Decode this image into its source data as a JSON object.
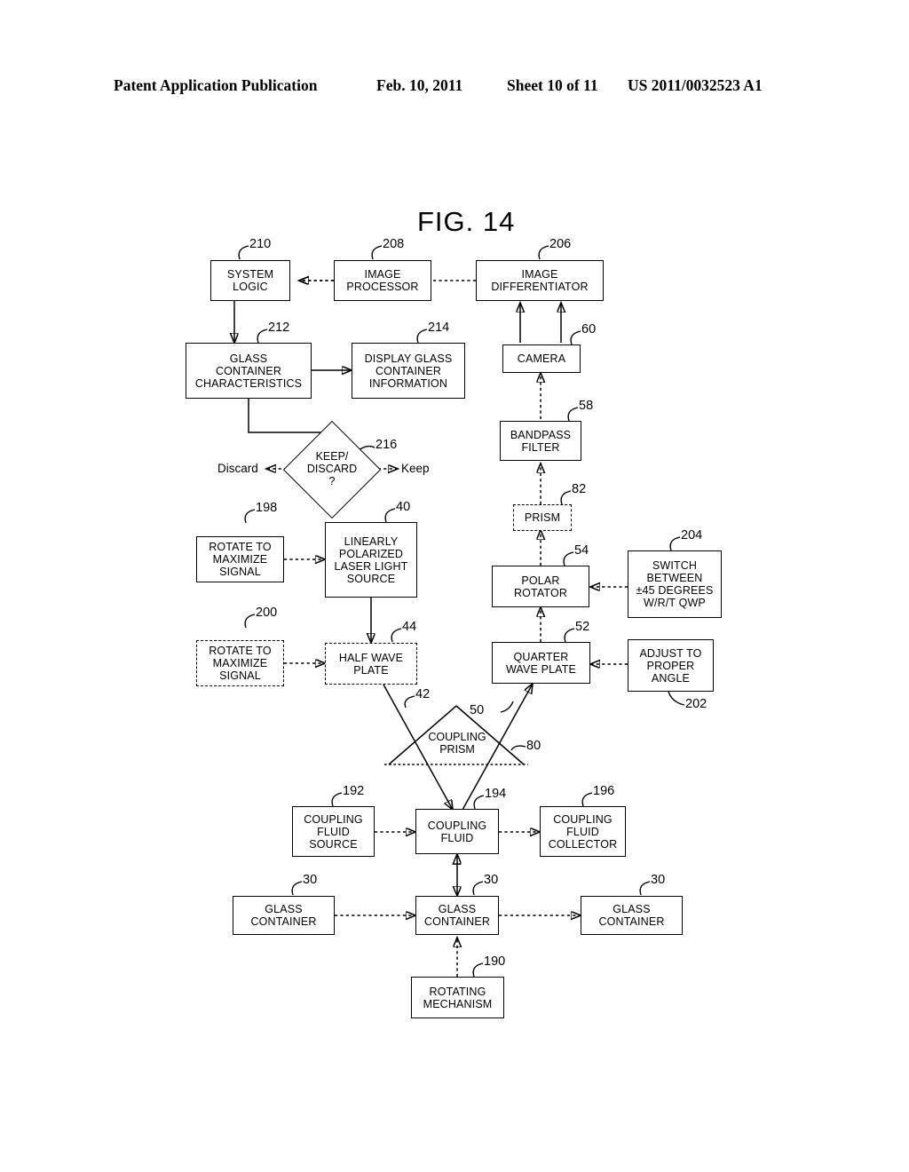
{
  "header": {
    "publication": "Patent Application Publication",
    "date": "Feb. 10, 2011",
    "sheet": "Sheet 10 of 11",
    "number": "US 2011/0032523 A1"
  },
  "figure": {
    "title": "FIG. 14"
  },
  "nodes": [
    {
      "id": "system-logic",
      "label": "SYSTEM\nLOGIC",
      "ref": "210",
      "style": "solid"
    },
    {
      "id": "image-processor",
      "label": "IMAGE\nPROCESSOR",
      "ref": "208",
      "style": "solid"
    },
    {
      "id": "image-differentiator",
      "label": "IMAGE\nDIFFERENTIATOR",
      "ref": "206",
      "style": "solid"
    },
    {
      "id": "glass-container-characteristics",
      "label": "GLASS\nCONTAINER\nCHARACTERISTICS",
      "ref": "212",
      "style": "solid"
    },
    {
      "id": "display-glass-container-information",
      "label": "DISPLAY GLASS\nCONTAINER\nINFORMATION",
      "ref": "214",
      "style": "solid"
    },
    {
      "id": "camera",
      "label": "CAMERA",
      "ref": "60",
      "style": "solid"
    },
    {
      "id": "bandpass-filter",
      "label": "BANDPASS\nFILTER",
      "ref": "58",
      "style": "solid"
    },
    {
      "id": "prism",
      "label": "PRISM",
      "ref": "82",
      "style": "dash"
    },
    {
      "id": "rotate-to-maximize-signal-198",
      "label": "ROTATE TO\nMAXIMIZE\nSIGNAL",
      "ref": "198",
      "style": "solid"
    },
    {
      "id": "linearly-polarized-laser-light-source",
      "label": "LINEARLY\nPOLARIZED\nLASER LIGHT\nSOURCE",
      "ref": "40",
      "style": "solid"
    },
    {
      "id": "polar-rotator",
      "label": "POLAR\nROTATOR",
      "ref": "54",
      "style": "solid"
    },
    {
      "id": "switch-between-degrees",
      "label": "SWITCH\nBETWEEN\n±45 DEGREES\nW/R/T QWP",
      "ref": "204",
      "style": "solid"
    },
    {
      "id": "rotate-to-maximize-signal-200",
      "label": "ROTATE TO\nMAXIMIZE\nSIGNAL",
      "ref": "200",
      "style": "dash"
    },
    {
      "id": "half-wave-plate",
      "label": "HALF WAVE\nPLATE",
      "ref": "44",
      "style": "dash"
    },
    {
      "id": "quarter-wave-plate",
      "label": "QUARTER\nWAVE PLATE",
      "ref": "52",
      "style": "solid"
    },
    {
      "id": "adjust-to-proper-angle",
      "label": "ADJUST TO\nPROPER\nANGLE",
      "ref": "202",
      "style": "solid"
    },
    {
      "id": "coupling-fluid-source",
      "label": "COUPLING\nFLUID\nSOURCE",
      "ref": "192",
      "style": "solid"
    },
    {
      "id": "coupling-fluid",
      "label": "COUPLING\nFLUID",
      "ref": "194",
      "style": "solid"
    },
    {
      "id": "coupling-fluid-collector",
      "label": "COUPLING\nFLUID\nCOLLECTOR",
      "ref": "196",
      "style": "solid"
    },
    {
      "id": "glass-container-left",
      "label": "GLASS\nCONTAINER",
      "ref": "30",
      "style": "solid"
    },
    {
      "id": "glass-container-center",
      "label": "GLASS\nCONTAINER",
      "ref": "30",
      "style": "solid"
    },
    {
      "id": "glass-container-right",
      "label": "GLASS\nCONTAINER",
      "ref": "30",
      "style": "solid"
    },
    {
      "id": "rotating-mechanism",
      "label": "ROTATING\nMECHANISM",
      "ref": "190",
      "style": "solid"
    }
  ],
  "decision": {
    "id": "keep-discard",
    "label": "KEEP/\nDISCARD\n?",
    "ref": "216",
    "branch_left": "Discard",
    "branch_right": "Keep"
  },
  "prism_shape": {
    "id": "coupling-prism",
    "label": "COUPLING\nPRISM",
    "ref": "80"
  },
  "beam_refs": {
    "incoming": "42",
    "outgoing": "50"
  },
  "colors": {
    "ink": "#000000",
    "paper": "#ffffff"
  }
}
